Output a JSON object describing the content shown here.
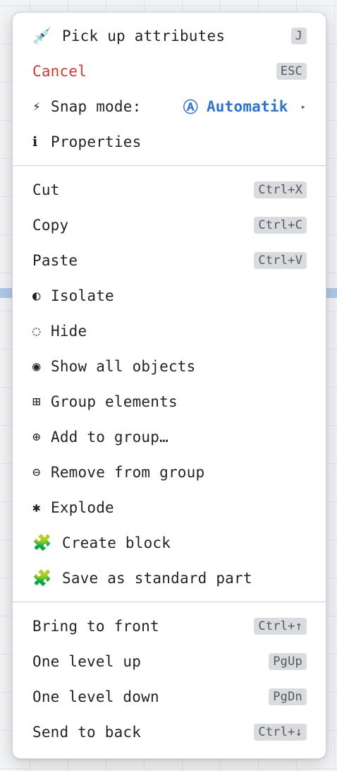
{
  "menu": {
    "section1": {
      "pick_up": {
        "icon": "💉",
        "label": "Pick up attributes",
        "shortcut": "J"
      },
      "cancel": {
        "label": "Cancel",
        "shortcut": "ESC"
      },
      "snap": {
        "icon": "⚡",
        "label": "Snap mode:",
        "value_icon": "Ⓐ",
        "value": "Automatik",
        "arrow": "▸"
      },
      "properties": {
        "icon": "ℹ",
        "label": "Properties"
      }
    },
    "section2": {
      "cut": {
        "label": "Cut",
        "shortcut": "Ctrl+X"
      },
      "copy": {
        "label": "Copy",
        "shortcut": "Ctrl+C"
      },
      "paste": {
        "label": "Paste",
        "shortcut": "Ctrl+V"
      },
      "isolate": {
        "icon": "◐",
        "label": "Isolate"
      },
      "hide": {
        "icon": "◌",
        "label": "Hide"
      },
      "show_all": {
        "icon": "◉",
        "label": "Show all objects"
      },
      "group": {
        "icon": "⊞",
        "label": "Group elements"
      },
      "add_group": {
        "icon": "⊕",
        "label": "Add to group…"
      },
      "remove_group": {
        "icon": "⊖",
        "label": "Remove from group"
      },
      "explode": {
        "icon": "✱",
        "label": "Explode"
      },
      "create_block": {
        "icon": "🧩",
        "label": "Create block"
      },
      "save_standard": {
        "icon": "🧩",
        "label": "Save as standard part"
      }
    },
    "section3": {
      "bring_front": {
        "label": "Bring to front",
        "shortcut": "Ctrl+↑"
      },
      "level_up": {
        "label": "One level up",
        "shortcut": "PgUp"
      },
      "level_down": {
        "label": "One level down",
        "shortcut": "PgDn"
      },
      "send_back": {
        "label": "Send to back",
        "shortcut": "Ctrl+↓"
      }
    }
  },
  "colors": {
    "danger": "#d03a32",
    "accent": "#2f72d6"
  }
}
